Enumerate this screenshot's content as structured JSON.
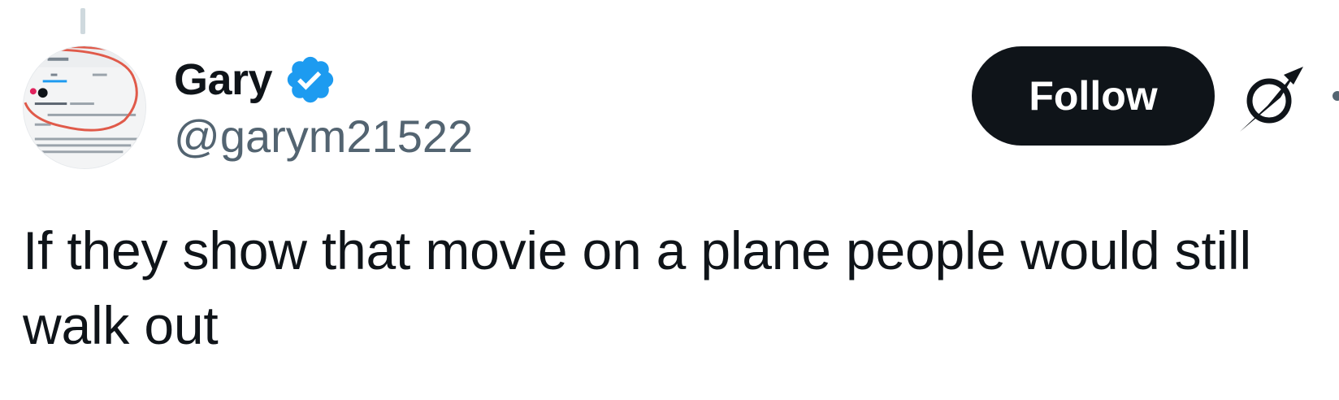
{
  "author": {
    "display_name": "Gary",
    "handle": "@garym21522",
    "verified": true,
    "verified_color": "#1d9bf0",
    "avatar_icon": "screenshot-avatar"
  },
  "actions": {
    "follow_label": "Follow",
    "grok_icon": "grok-icon",
    "more_icon": "more-icon"
  },
  "tweet": {
    "text": "If they show that movie on a plane people would still walk out"
  },
  "colors": {
    "primary_text": "#0f1419",
    "secondary_text": "#536471",
    "button_bg": "#0f1419",
    "button_text": "#ffffff",
    "thread_line": "#cfd9de"
  }
}
